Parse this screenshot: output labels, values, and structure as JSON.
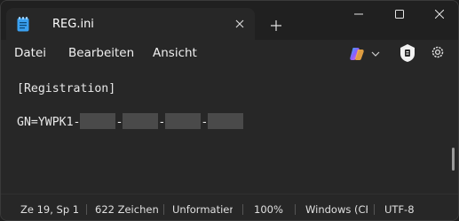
{
  "window": {
    "tab_title": "REG.ini",
    "tab_close_icon": "close-icon",
    "new_tab_icon": "plus-icon",
    "minimize_icon": "minimize-icon",
    "maximize_icon": "maximize-icon",
    "close_icon": "close-icon"
  },
  "menu": {
    "items": [
      "Datei",
      "Bearbeiten",
      "Ansicht"
    ]
  },
  "toolbar": {
    "copilot_icon": "copilot-icon",
    "dropdown_icon": "chevron-down-icon",
    "badge_icon": "copilot-badge-icon",
    "settings_icon": "gear-icon"
  },
  "editor": {
    "line1": "[Registration]",
    "line2_prefix": "GN=YWPK1-",
    "separator": "-"
  },
  "status": {
    "position": "Ze 19, Sp 1",
    "chars": "622 Zeichen",
    "format": "Unformatier",
    "zoom": "100%",
    "line_ending": "Windows (CF",
    "encoding": "UTF-8"
  },
  "colors": {
    "background": "#272727",
    "titlebar": "#202020",
    "accent": "#4aa8ff"
  }
}
